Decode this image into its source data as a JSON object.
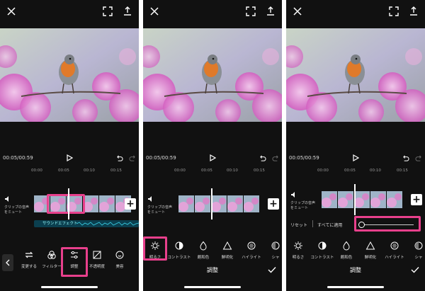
{
  "panels": [
    {
      "time": "00:05/00:59",
      "ruler": [
        "00:00",
        "00:05",
        "00:10",
        "00:15"
      ],
      "mute_label": "クリップの音声をミュート",
      "sound_track_label": "サウンドエフェクト",
      "tools": [
        {
          "label": "変更する",
          "icon": "swap-icon"
        },
        {
          "label": "フィルター",
          "icon": "filter-icon"
        },
        {
          "label": "調整",
          "icon": "sliders-icon"
        },
        {
          "label": "不透明度",
          "icon": "opacity-icon"
        },
        {
          "label": "美容",
          "icon": "beauty-icon"
        }
      ]
    },
    {
      "time": "00:05/00:59",
      "ruler": [
        "00:00",
        "00:05",
        "00:10",
        "00:15"
      ],
      "mute_label": "クリップの音声をミュート",
      "title": "調整",
      "tools": [
        {
          "label": "明るさ",
          "icon": "sun-icon"
        },
        {
          "label": "コントラスト",
          "icon": "contrast-icon"
        },
        {
          "label": "飽和色",
          "icon": "drop-icon"
        },
        {
          "label": "鮮明化",
          "icon": "triangle-icon"
        },
        {
          "label": "ハイライト",
          "icon": "highlight-icon"
        },
        {
          "label": "シャ",
          "icon": "shadow-icon"
        }
      ]
    },
    {
      "time": "00:05/00:59",
      "ruler": [
        "00:00",
        "00:05",
        "00:10",
        "00:15"
      ],
      "mute_label": "クリップの音声をミュート",
      "title": "調整",
      "reset_label": "リセット",
      "apply_all_label": "すべてに適用",
      "slider_value_fraction": 0.0,
      "tools": [
        {
          "label": "明るさ",
          "icon": "sun-icon"
        },
        {
          "label": "コントラスト",
          "icon": "contrast-icon"
        },
        {
          "label": "飽和色",
          "icon": "drop-icon"
        },
        {
          "label": "鮮明化",
          "icon": "triangle-icon"
        },
        {
          "label": "ハイライト",
          "icon": "highlight-icon"
        },
        {
          "label": "シャ",
          "icon": "shadow-icon"
        }
      ]
    }
  ],
  "colors": {
    "highlight": "#e8408c",
    "background": "#111111",
    "sound_track": "#0b3f4f"
  }
}
